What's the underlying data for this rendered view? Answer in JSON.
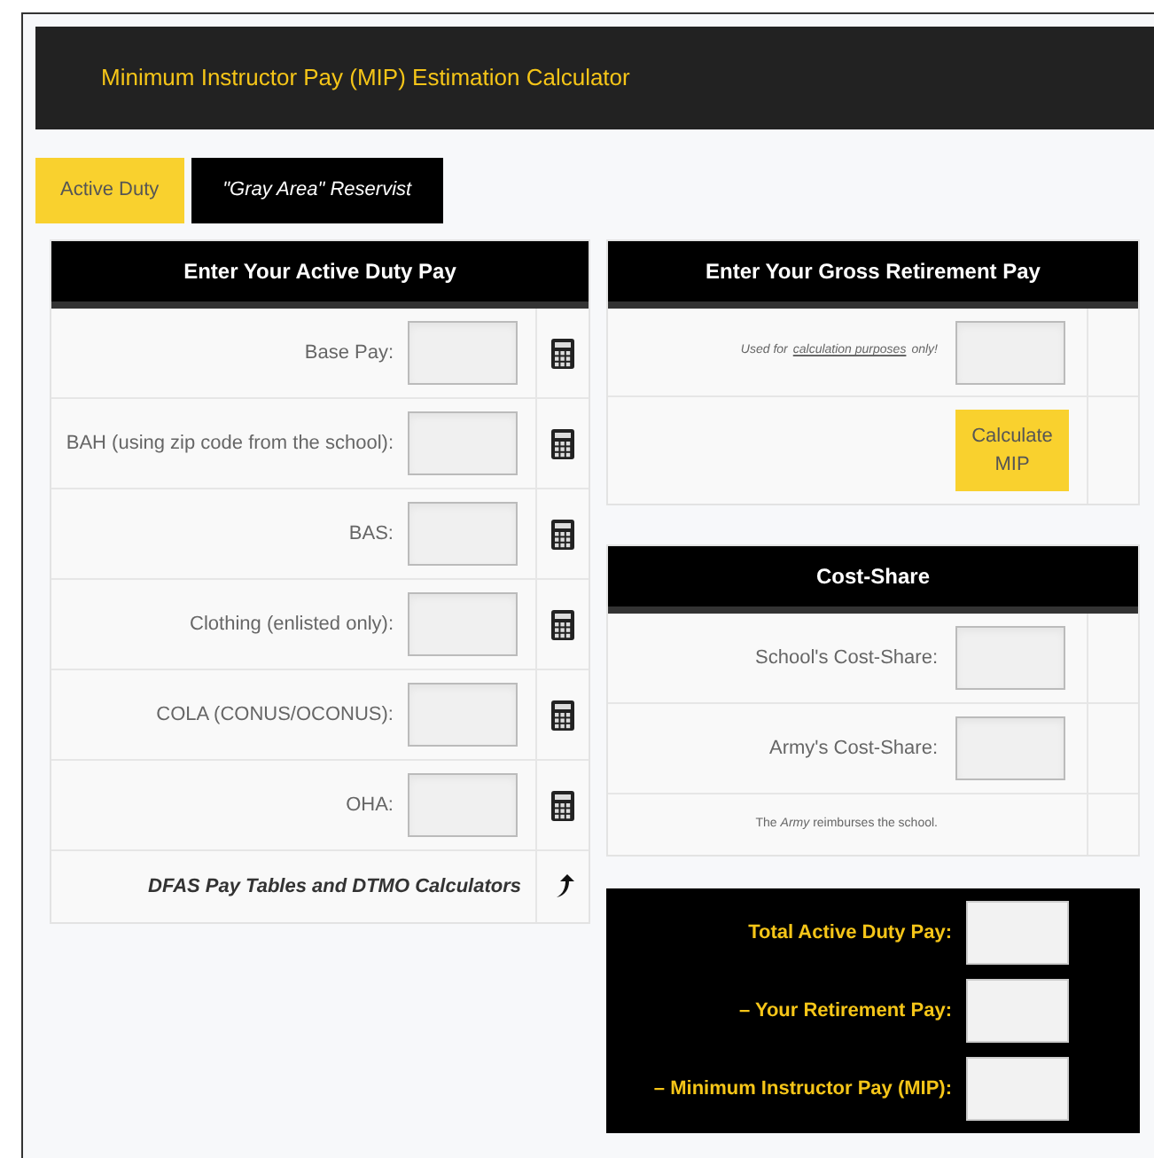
{
  "header": {
    "title": "Minimum Instructor Pay (MIP) Estimation Calculator"
  },
  "tabs": [
    {
      "label": "Active Duty",
      "selected": true
    },
    {
      "label": "\"Gray Area\" Reservist",
      "selected": false
    }
  ],
  "active_duty_pay": {
    "title": "Enter Your Active Duty Pay",
    "rows": [
      {
        "label": "Base Pay:"
      },
      {
        "label": "BAH (using zip code from the school):"
      },
      {
        "label": "BAS:"
      },
      {
        "label": "Clothing (enlisted only):"
      },
      {
        "label": "COLA (CONUS/OCONUS):"
      },
      {
        "label": "OHA:"
      }
    ],
    "footer_link": "DFAS Pay Tables and DTMO Calculators"
  },
  "retirement_pay": {
    "title": "Enter Your Gross Retirement Pay",
    "note_before": "Used for",
    "note_link": "calculation purposes",
    "note_after": "only!",
    "button": "Calculate MIP"
  },
  "cost_share": {
    "title": "Cost-Share",
    "rows": [
      {
        "label": "School's Cost-Share:"
      },
      {
        "label": "Army's Cost-Share:"
      }
    ],
    "note": "The *Army* reimburses the school."
  },
  "results": [
    {
      "label": "Total Active Duty Pay:"
    },
    {
      "label": "– Your Retirement Pay:"
    },
    {
      "label": "– Minimum Instructor Pay (MIP):"
    }
  ]
}
